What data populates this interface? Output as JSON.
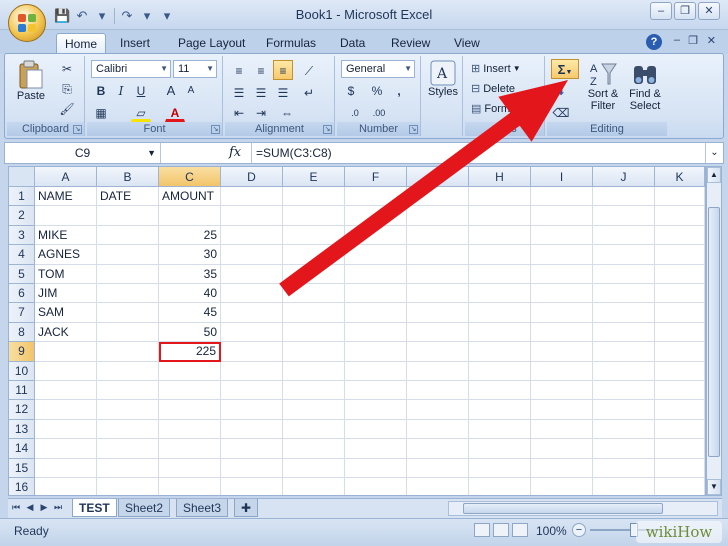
{
  "window": {
    "title": "Book1 - Microsoft Excel",
    "minimize": "–",
    "restore": "❐",
    "close": "✕"
  },
  "qat": {
    "save": "💾",
    "undo": "↶",
    "redo": "↷",
    "more": "▾"
  },
  "tabs": [
    "Home",
    "Insert",
    "Page Layout",
    "Formulas",
    "Data",
    "Review",
    "View"
  ],
  "help": "?",
  "ribbon": {
    "clipboard": {
      "paste": "Paste",
      "label": "Clipboard"
    },
    "font": {
      "name": "Calibri",
      "size": "11",
      "bold": "B",
      "italic": "I",
      "underline": "U",
      "grow": "A",
      "shrink": "A",
      "fill": "A",
      "color": "A",
      "label": "Font"
    },
    "alignment": {
      "label": "Alignment"
    },
    "number": {
      "format": "General",
      "currency": "$",
      "percent": "%",
      "comma": ",",
      "inc": ".0",
      "dec": ".00",
      "label": "Number"
    },
    "styles": {
      "label": "Styles"
    },
    "cells": {
      "insert": "Insert",
      "delete": "Delete",
      "format": "Format",
      "label": "Cells"
    },
    "editing": {
      "sum": "Σ",
      "sort_filter_1": "Sort &",
      "sort_filter_2": "Filter",
      "find_select_1": "Find &",
      "find_select_2": "Select",
      "label": "Editing"
    }
  },
  "formula_bar": {
    "name_box": "C9",
    "fx": "fx",
    "formula": "=SUM(C3:C8)"
  },
  "columns": [
    "A",
    "B",
    "C",
    "D",
    "E",
    "F",
    "G",
    "H",
    "I",
    "J",
    "K"
  ],
  "rows": [
    "1",
    "2",
    "3",
    "4",
    "5",
    "6",
    "7",
    "8",
    "9",
    "10",
    "11",
    "12",
    "13",
    "14",
    "15",
    "16"
  ],
  "cells": {
    "A1": "NAME",
    "B1": "DATE",
    "C1": "AMOUNT",
    "A3": "MIKE",
    "C3": "25",
    "A4": "AGNES",
    "C4": "30",
    "A5": "TOM",
    "C5": "35",
    "A6": "JIM",
    "C6": "40",
    "A7": "SAM",
    "C7": "45",
    "A8": "JACK",
    "C8": "50",
    "C9": "225"
  },
  "sheets": [
    "TEST",
    "Sheet2",
    "Sheet3"
  ],
  "status": {
    "text": "Ready",
    "zoom": "100%"
  },
  "watermark": "wikiHow",
  "colors": {
    "arrow": "#e3171b",
    "selection": "#e3171b",
    "accent": "#2a5db0"
  }
}
